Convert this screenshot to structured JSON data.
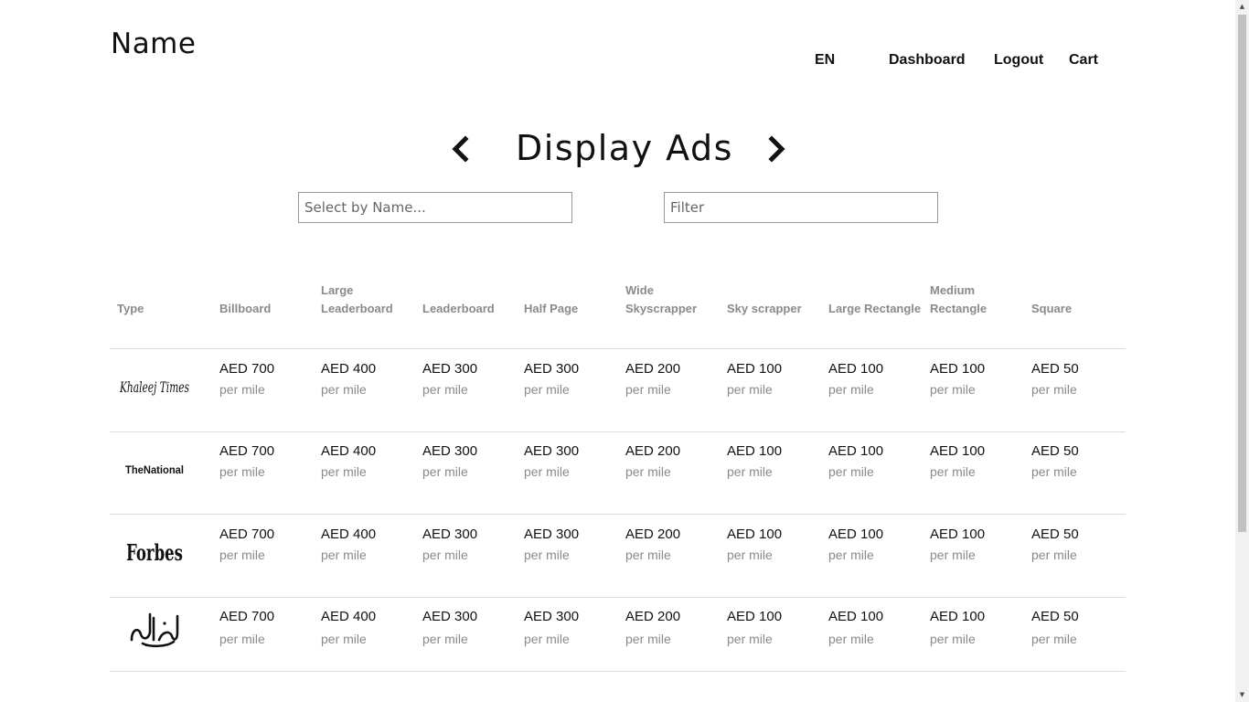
{
  "header": {
    "brand": "Name",
    "nav": {
      "language": "EN",
      "dashboard": "Dashboard",
      "logout": "Logout",
      "cart": "Cart"
    }
  },
  "page": {
    "title": "Display Ads",
    "search_placeholder": "Select by Name...",
    "filter_placeholder": "Filter"
  },
  "table": {
    "columns": [
      "Type",
      "Billboard",
      "Large Leaderboard",
      "Leaderboard",
      "Half Page",
      "Wide Skyscrapper",
      "Sky scrapper",
      "Large Rectangle",
      "Medium Rectangle",
      "Square"
    ],
    "rows": [
      {
        "publisher": "Khaleej Times",
        "prices": [
          "AED 700",
          "AED 400",
          "AED 300",
          "AED 300",
          "AED 200",
          "AED 100",
          "AED 100",
          "AED 100",
          "AED 50"
        ],
        "unit": "per mile"
      },
      {
        "publisher": "The National",
        "prices": [
          "AED 700",
          "AED 400",
          "AED 300",
          "AED 300",
          "AED 200",
          "AED 100",
          "AED 100",
          "AED 100",
          "AED 50"
        ],
        "unit": "per mile"
      },
      {
        "publisher": "Forbes",
        "prices": [
          "AED 700",
          "AED 400",
          "AED 300",
          "AED 300",
          "AED 200",
          "AED 100",
          "AED 100",
          "AED 100",
          "AED 50"
        ],
        "unit": "per mile"
      },
      {
        "publisher": "Al Bayan",
        "prices": [
          "AED 700",
          "AED 400",
          "AED 300",
          "AED 300",
          "AED 200",
          "AED 100",
          "AED 100",
          "AED 100",
          "AED 50"
        ],
        "unit": "per mile"
      }
    ]
  }
}
